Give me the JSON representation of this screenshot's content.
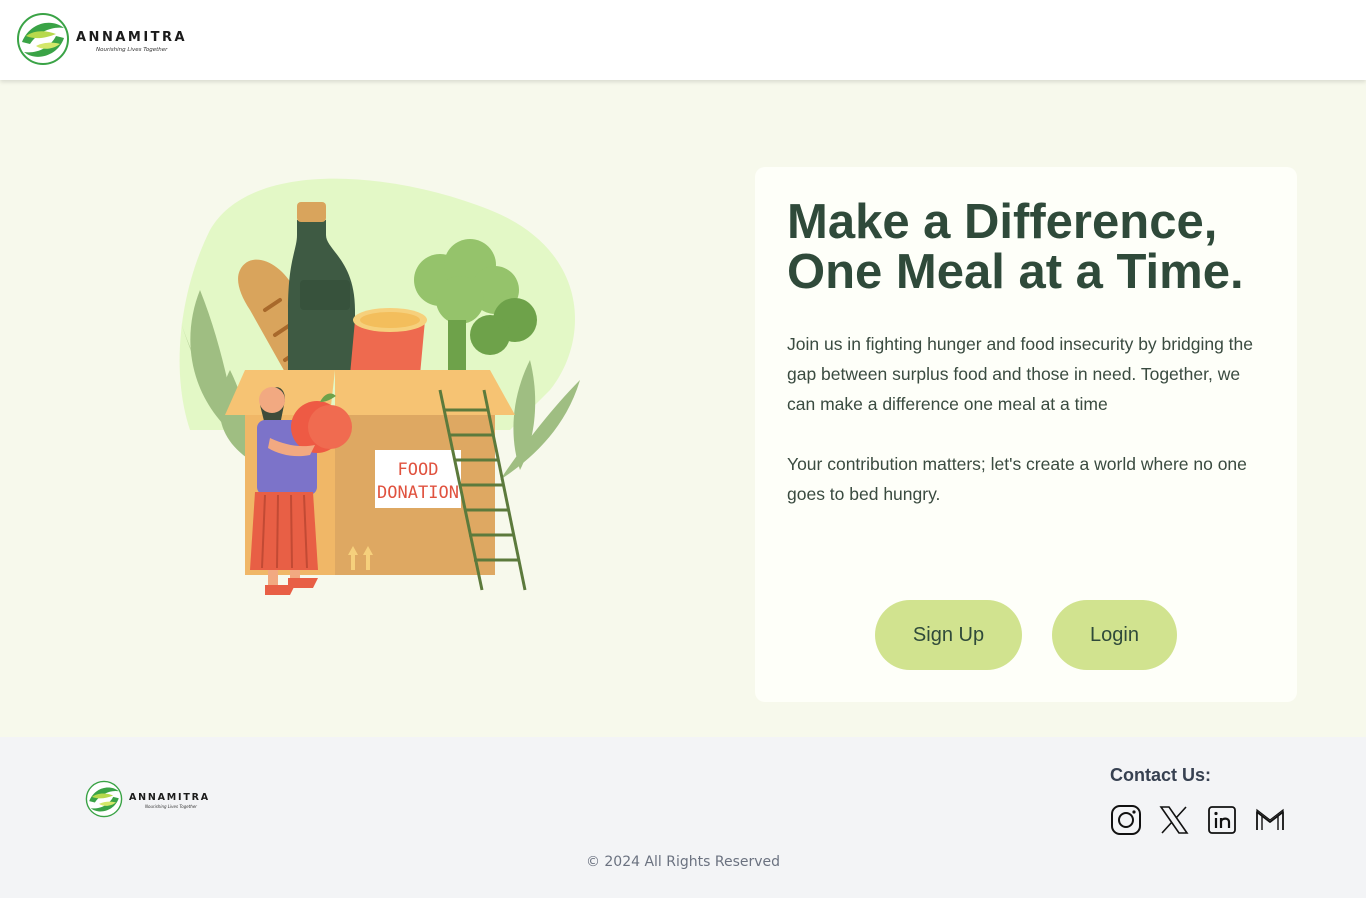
{
  "brand": {
    "name": "ANNAMITRA",
    "tagline": "Nourishing Lives Together"
  },
  "illustration": {
    "box_label": "FOOD\nDONATION",
    "box_label_line1": "FOOD",
    "box_label_line2": "DONATION"
  },
  "hero": {
    "headline": "Make a Difference, One Meal at a Time.",
    "paragraph1": "Join us in fighting hunger and food insecurity by bridging the gap between surplus food and those in need. Together, we can make a difference one meal at a time",
    "paragraph2": "Your contribution matters; let's create a world where no one goes to bed hungry.",
    "signup_label": "Sign Up",
    "login_label": "Login"
  },
  "footer": {
    "contact_title": "Contact Us:",
    "social_icons": [
      "instagram-icon",
      "x-icon",
      "linkedin-icon",
      "gmail-icon"
    ],
    "copyright": "© 2024 All Rights Reserved"
  },
  "colors": {
    "accent": "#d1e38f",
    "heading": "#2f4a3a",
    "page_bg": "#f7f9ec",
    "footer_bg": "#f3f4f6"
  }
}
